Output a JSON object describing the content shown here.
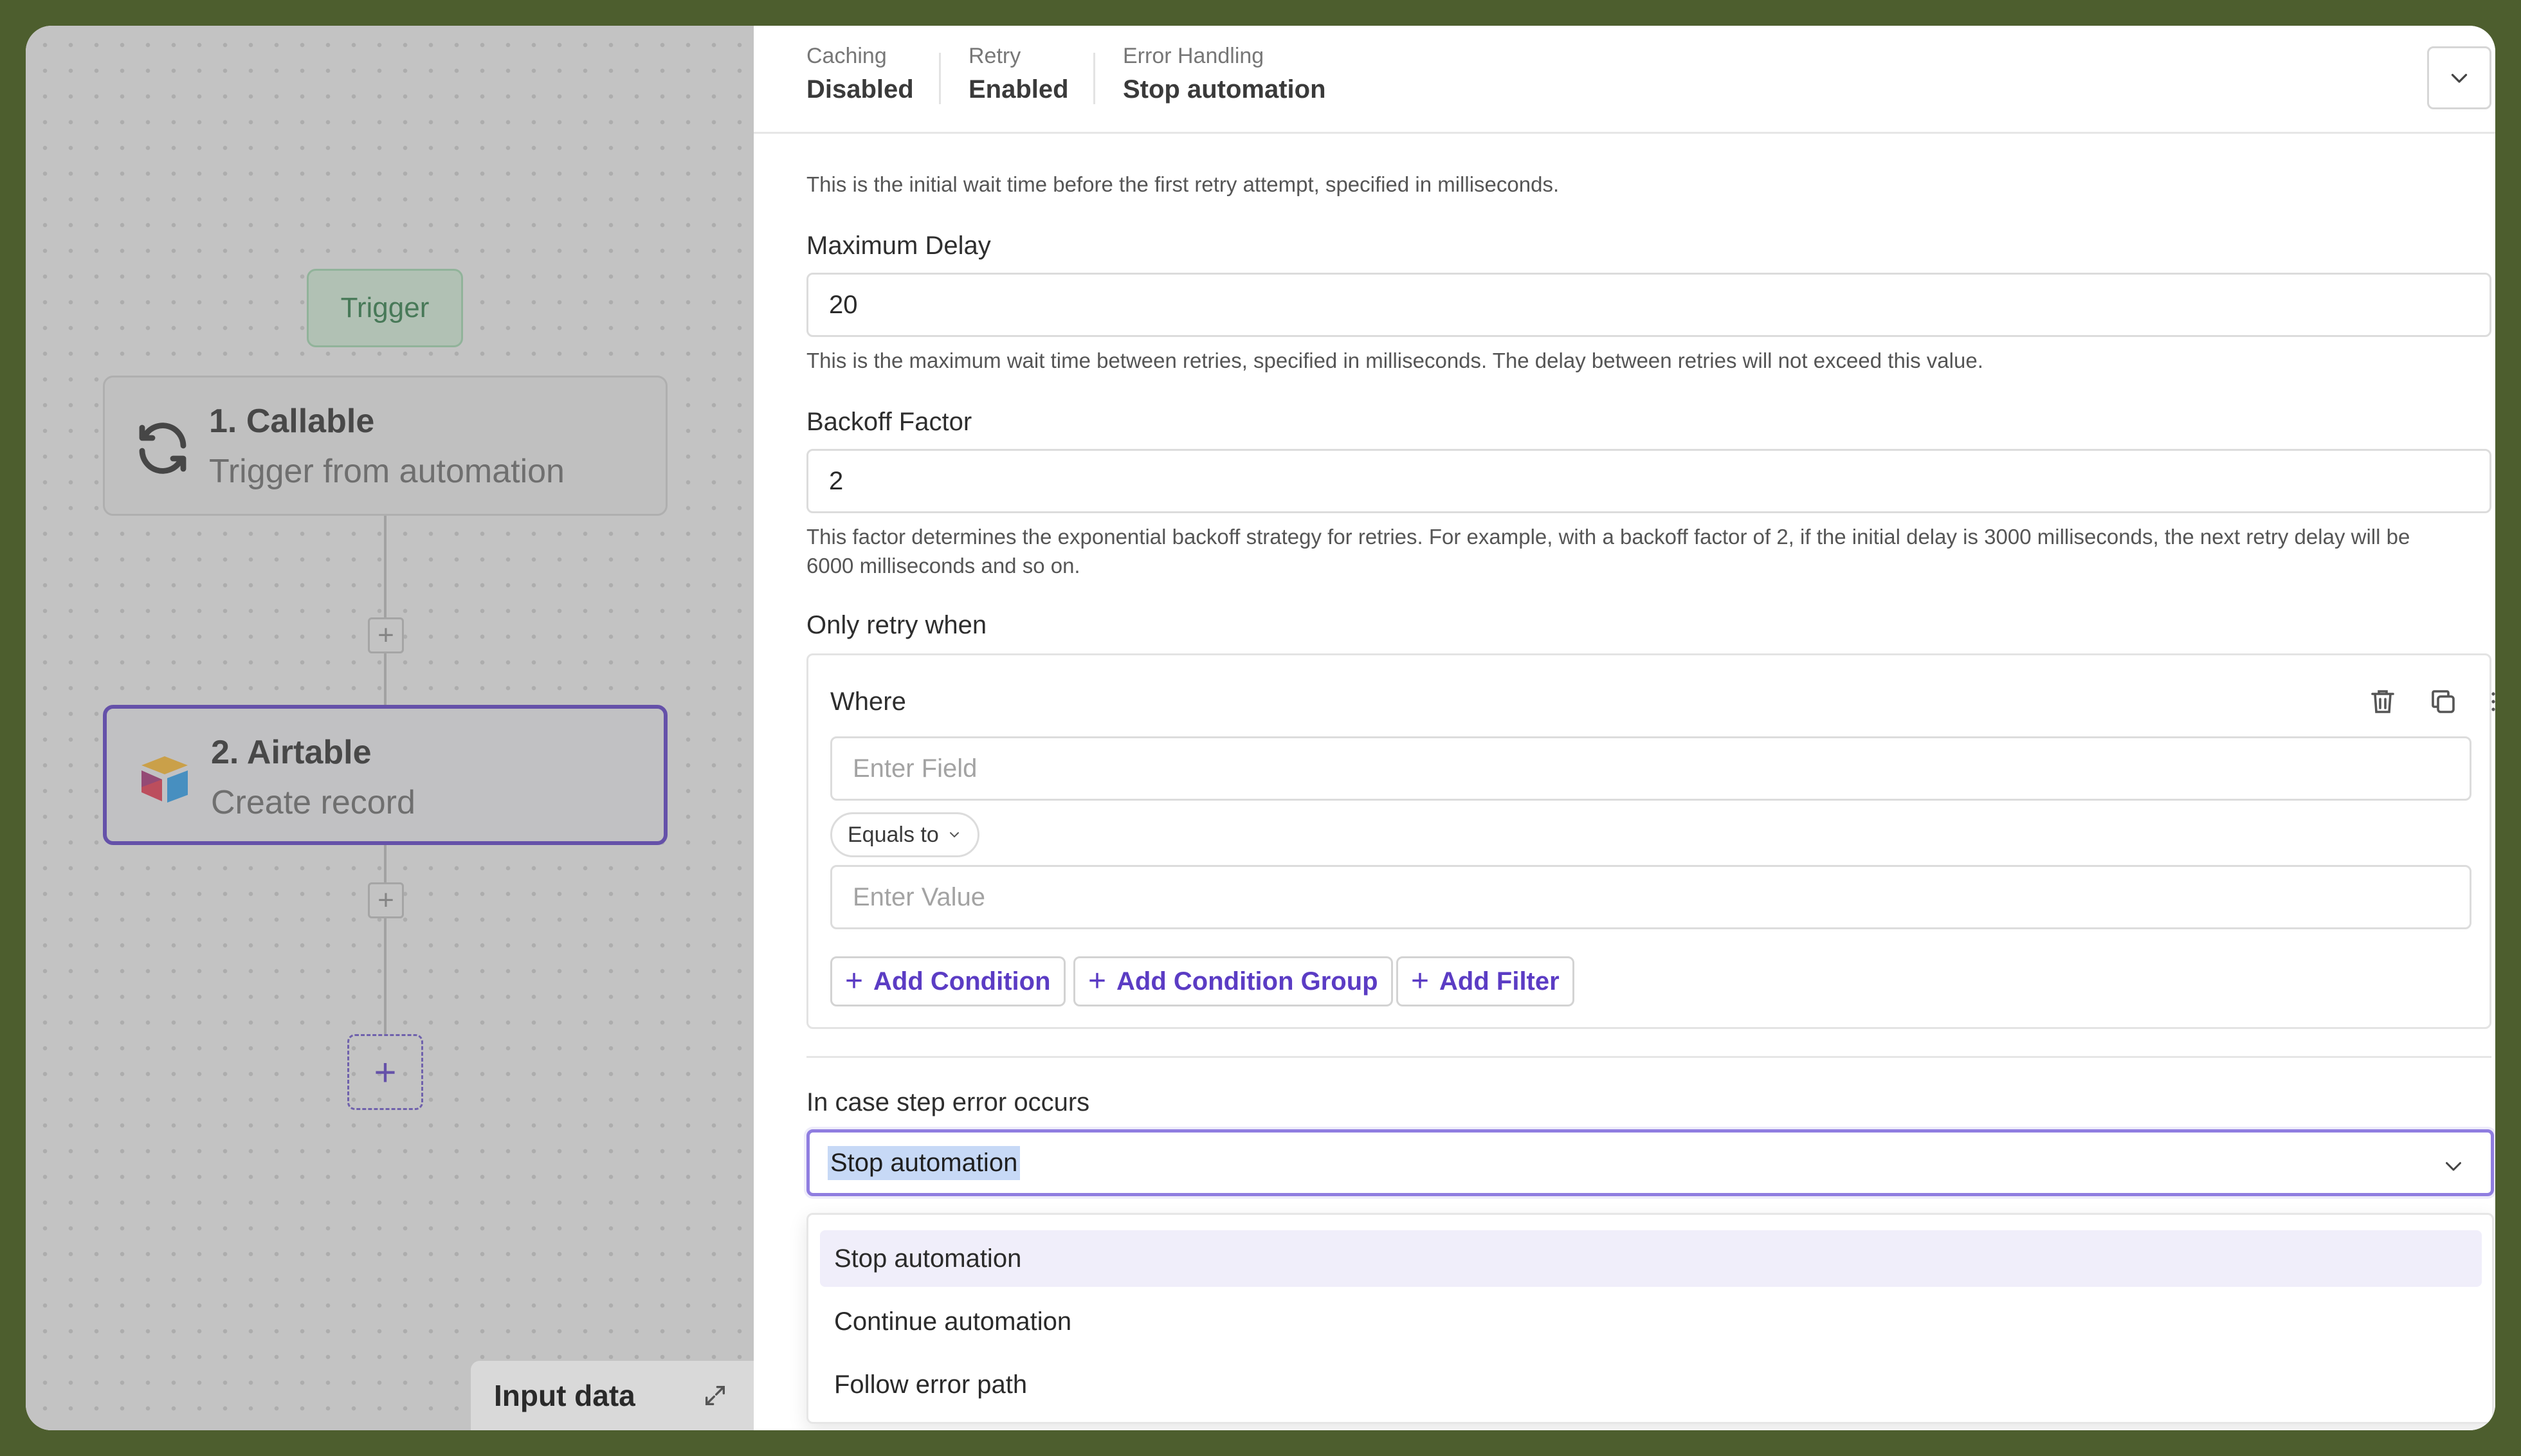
{
  "canvas": {
    "trigger_label": "Trigger",
    "nodes": [
      {
        "title": "1. Callable",
        "subtitle": "Trigger from automation",
        "icon": "refresh-icon"
      },
      {
        "title": "2. Airtable",
        "subtitle": "Create record",
        "icon": "airtable-logo-icon"
      }
    ],
    "input_data_label": "Input data"
  },
  "summary": [
    {
      "label": "Caching",
      "value": "Disabled"
    },
    {
      "label": "Retry",
      "value": "Enabled"
    },
    {
      "label": "Error Handling",
      "value": "Stop automation"
    }
  ],
  "form": {
    "initial_delay_help": "This is the initial wait time before the first retry attempt, specified in milliseconds.",
    "max_delay_label": "Maximum Delay",
    "max_delay_value": "20",
    "max_delay_help": "This is the maximum wait time between retries, specified in milliseconds. The delay between retries will not exceed this value.",
    "backoff_label": "Backoff Factor",
    "backoff_value": "2",
    "backoff_help": "This factor determines the exponential backoff strategy for retries. For example, with a backoff factor of 2, if the initial delay is 3000 milliseconds, the next retry delay will be 6000 milliseconds and so on.",
    "only_retry_label": "Only retry when",
    "condition": {
      "where_label": "Where",
      "field_placeholder": "Enter Field",
      "operator": "Equals to",
      "value_placeholder": "Enter Value",
      "buttons": [
        "Add Condition",
        "Add Condition Group",
        "Add Filter"
      ]
    },
    "error_label": "In case step error occurs",
    "error_selected": "Stop automation",
    "error_options": [
      "Stop automation",
      "Continue automation",
      "Follow error path"
    ]
  },
  "colors": {
    "accent": "#5b3cc4",
    "trigger_green": "#2f7a47",
    "frame_bg": "#4d5e2e"
  }
}
